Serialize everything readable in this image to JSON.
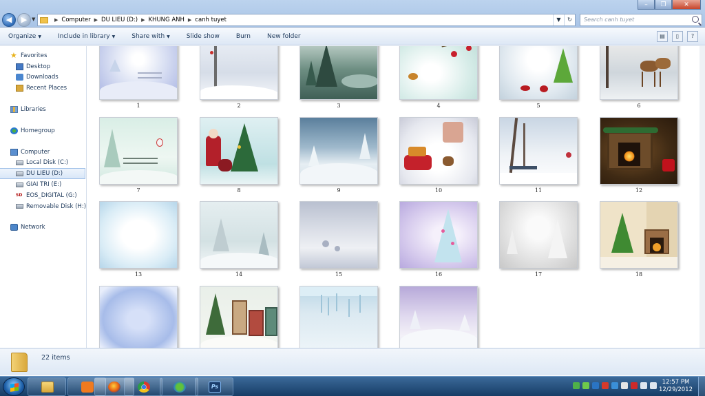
{
  "window": {
    "breadcrumbs": [
      "Computer",
      "DU LIEU (D:)",
      "KHUNG ANH",
      "canh tuyet"
    ],
    "search_placeholder": "Search canh tuyet"
  },
  "toolbar": {
    "organize": "Organize",
    "include_in_library": "Include in library",
    "share_with": "Share with",
    "slide_show": "Slide show",
    "burn": "Burn",
    "new_folder": "New folder"
  },
  "nav": {
    "favorites": "Favorites",
    "desktop": "Desktop",
    "downloads": "Downloads",
    "recent_places": "Recent Places",
    "libraries": "Libraries",
    "homegroup": "Homegroup",
    "computer": "Computer",
    "local_disk": "Local Disk (C:)",
    "du_lieu": "DU LIEU (D:)",
    "giai_tri": "GIAI TRI (E:)",
    "eos_digital": "EOS_DIGITAL (G:)",
    "removable": "Removable Disk (H:)",
    "network": "Network"
  },
  "items": [
    {
      "label": "1"
    },
    {
      "label": "2"
    },
    {
      "label": "3"
    },
    {
      "label": "4"
    },
    {
      "label": "5"
    },
    {
      "label": "6"
    },
    {
      "label": "7"
    },
    {
      "label": "8"
    },
    {
      "label": "9"
    },
    {
      "label": "10"
    },
    {
      "label": "11"
    },
    {
      "label": "12"
    },
    {
      "label": "13"
    },
    {
      "label": "14"
    },
    {
      "label": "15"
    },
    {
      "label": "16"
    },
    {
      "label": "17"
    },
    {
      "label": "18"
    },
    {
      "label": ""
    },
    {
      "label": ""
    },
    {
      "label": ""
    },
    {
      "label": ""
    }
  ],
  "details": {
    "count": "22 items"
  },
  "taskbar": {
    "time": "12:57 PM",
    "date": "12/29/2012"
  }
}
